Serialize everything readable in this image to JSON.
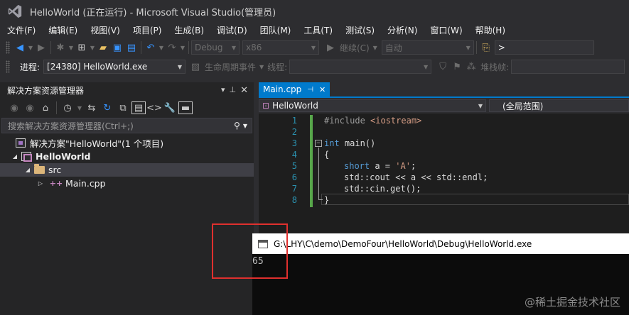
{
  "window": {
    "title": "HelloWorld (正在运行) - Microsoft Visual Studio(管理员)"
  },
  "menu": {
    "items": [
      "文件(F)",
      "编辑(E)",
      "视图(V)",
      "项目(P)",
      "生成(B)",
      "调试(D)",
      "团队(M)",
      "工具(T)",
      "测试(S)",
      "分析(N)",
      "窗口(W)",
      "帮助(H)"
    ]
  },
  "toolbar": {
    "config": "Debug",
    "platform": "x86",
    "continue_label": "继续(C)",
    "auto_label": "自动",
    "search_value": ">"
  },
  "debug_toolbar": {
    "process_label": "进程:",
    "process_value": "[24380] HelloWorld.exe",
    "lifecycle_label": "生命周期事件",
    "thread_label": "线程:",
    "stackframe_label": "堆栈帧:"
  },
  "solution_explorer": {
    "title": "解决方案资源管理器",
    "search_placeholder": "搜索解决方案资源管理器(Ctrl+;)",
    "solution_label": "解决方案\"HelloWorld\"(1 个项目)",
    "project_label": "HelloWorld",
    "folder_label": "src",
    "file_label": "Main.cpp"
  },
  "editor": {
    "tab_label": "Main.cpp",
    "nav_left": "HelloWorld",
    "nav_right": "(全局范围)",
    "line_numbers": [
      "1",
      "2",
      "3",
      "4",
      "5",
      "6",
      "7",
      "8"
    ],
    "lines": {
      "l1_pp": "#include ",
      "l1_str": "<iostream>",
      "l3_kw": "int",
      "l3_rest": " main()",
      "l4": "{",
      "l5_kw": "short",
      "l5_rest": " a = ",
      "l5_str": "'A'",
      "l5_end": ";",
      "l6": "std::cout << a << std::endl;",
      "l7": "std::cin.get();",
      "l8": "}"
    }
  },
  "console": {
    "title": "G:\\LHY\\C\\demo\\DemoFour\\HelloWorld\\Debug\\HelloWorld.exe",
    "output": "65"
  },
  "watermark": "@稀土掘金技术社区",
  "colors": {
    "accent": "#007acc",
    "highlight_box": "#e0302e"
  }
}
